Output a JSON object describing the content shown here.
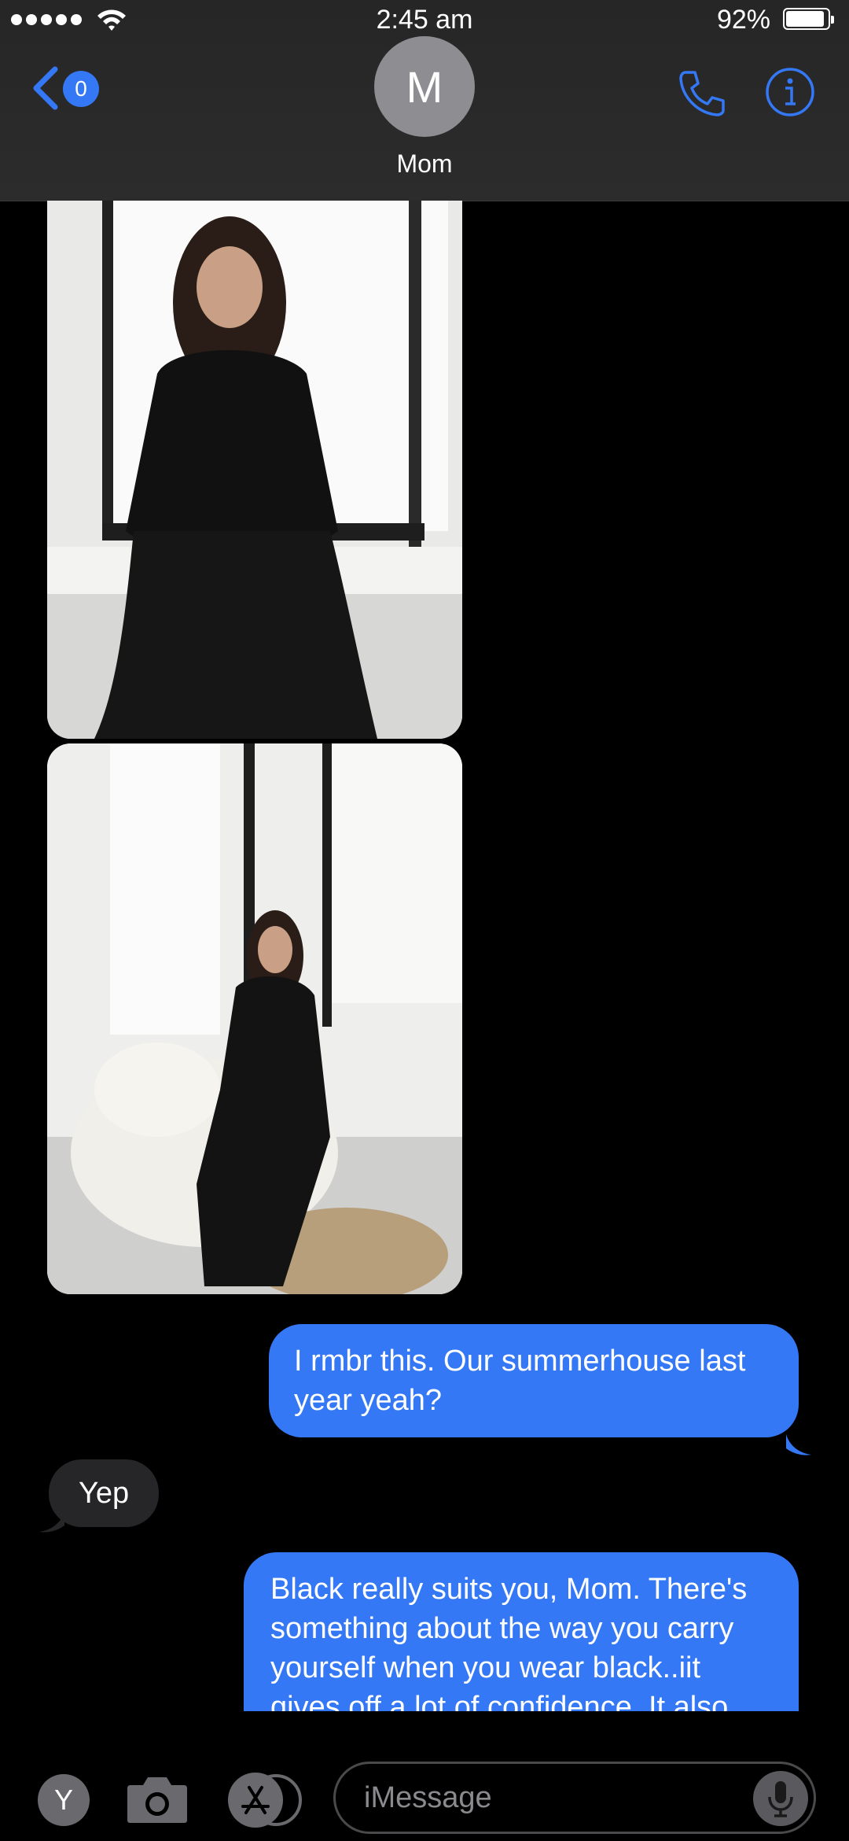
{
  "status": {
    "time": "2:45 am",
    "battery": "92%",
    "battery_level": 0.92
  },
  "header": {
    "back_badge": "0",
    "avatar_initial": "M",
    "contact_name": "Mom"
  },
  "messages": [
    {
      "from": "contact",
      "type": "photo",
      "description": "photo"
    },
    {
      "from": "contact",
      "type": "photo",
      "description": "photo"
    },
    {
      "from": "me",
      "text": "I rmbr this. Our summerhouse last year yeah?"
    },
    {
      "from": "contact",
      "text": "Yep"
    },
    {
      "from": "me",
      "text": "Black really suits you, Mom. There's something about the way you carry yourself when you wear black..iit gives off a lot of confidence. It also"
    }
  ],
  "composer": {
    "apps_initial": "Y",
    "placeholder": "iMessage"
  },
  "colors": {
    "accent": "#3478f6",
    "incoming_bubble": "#262628",
    "header_bg": "#2a2a2a"
  }
}
